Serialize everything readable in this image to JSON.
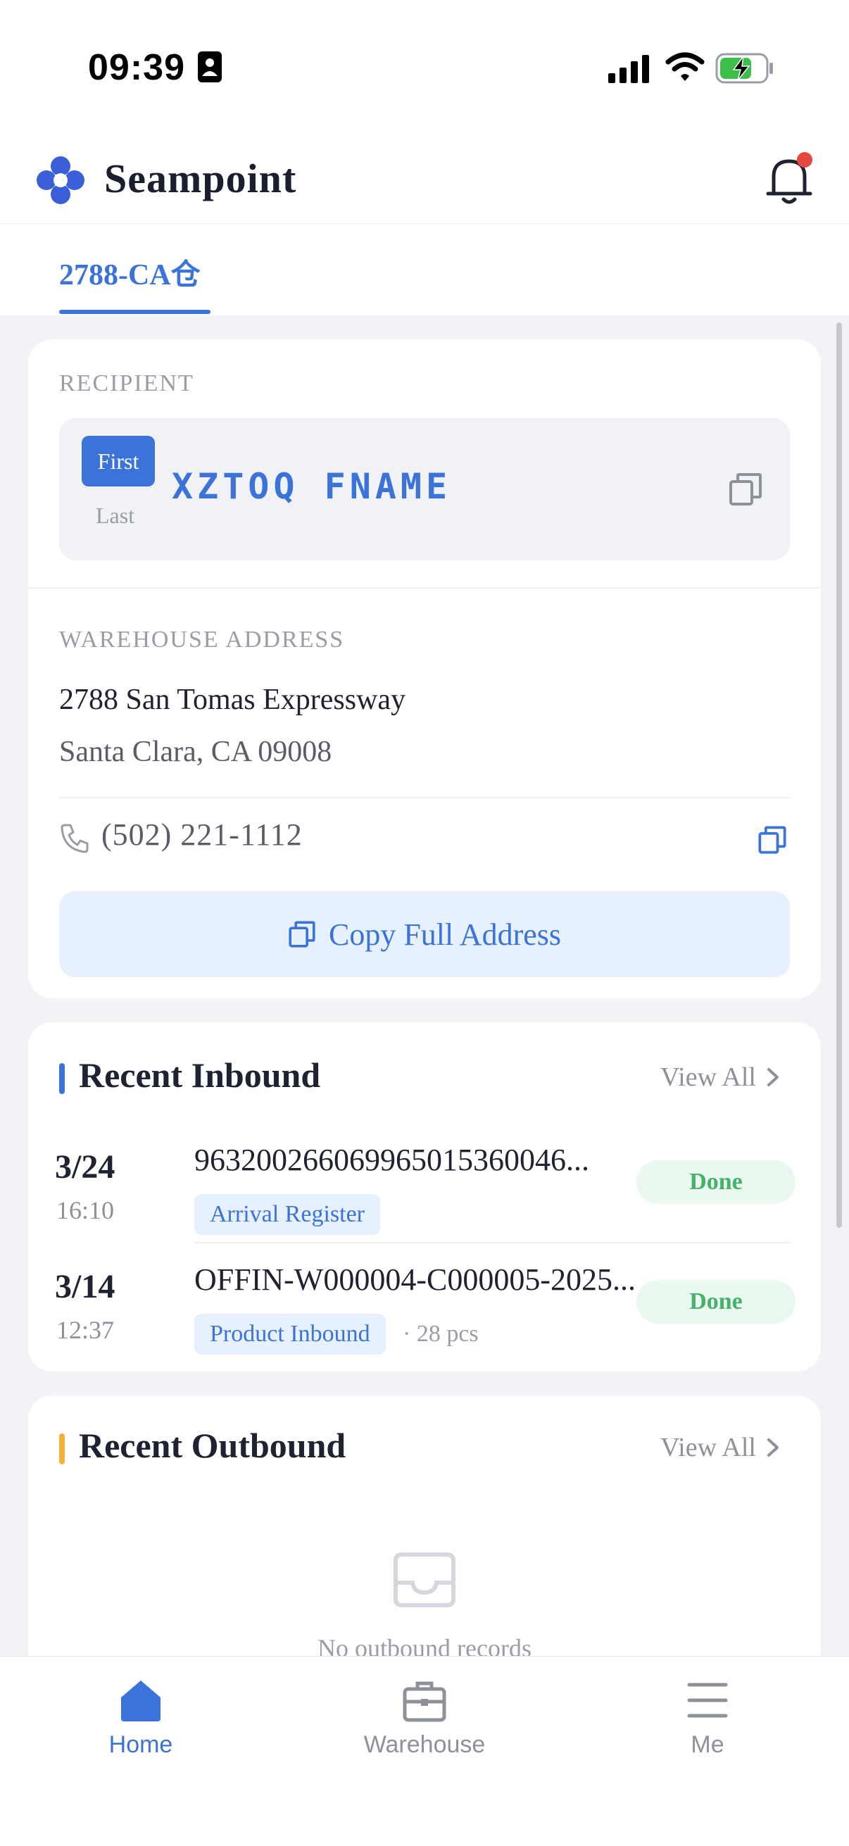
{
  "status_bar": {
    "time": "09:39",
    "icons": [
      "id-card-icon",
      "signal-icon",
      "wifi-icon",
      "battery-charging-icon"
    ]
  },
  "header": {
    "app_name": "Seampoint",
    "logo_icon": "seampoint-logo-icon",
    "notification_icon": "bell-icon",
    "has_unread": true
  },
  "tabs": [
    {
      "label": "2788-CA仓",
      "active": true
    }
  ],
  "address_card": {
    "recipient_label": "RECIPIENT",
    "first_badge": "First",
    "last_label": "Last",
    "recipient_name": "XZTOQ FNAME",
    "warehouse_label": "WAREHOUSE ADDRESS",
    "address_line1": "2788 San Tomas Expressway",
    "address_line2": "Santa Clara, CA 09008",
    "phone": "(502) 221-1112",
    "copy_full_label": "Copy Full Address"
  },
  "recent_inbound": {
    "title": "Recent Inbound",
    "view_all": "View All",
    "rows": [
      {
        "date": "3/24",
        "time": "16:10",
        "code": "963200266069965015360046...",
        "tag": "Arrival Register",
        "qty": "",
        "status": "Done"
      },
      {
        "date": "3/14",
        "time": "12:37",
        "code": "OFFIN-W000004-C000005-2025...",
        "tag": "Product Inbound",
        "qty": "· 28 pcs",
        "status": "Done"
      }
    ]
  },
  "recent_outbound": {
    "title": "Recent Outbound",
    "view_all": "View All",
    "empty_text": "No outbound records"
  },
  "bottom_nav": {
    "items": [
      {
        "label": "Home",
        "icon": "home-icon",
        "active": true
      },
      {
        "label": "Warehouse",
        "icon": "briefcase-icon",
        "active": false
      },
      {
        "label": "Me",
        "icon": "menu-icon",
        "active": false
      }
    ]
  },
  "colors": {
    "accent": "#3b73d9",
    "inbound_bar": "#3b73d9",
    "outbound_bar": "#f0b23a",
    "done_text": "#44b26b",
    "done_bg": "#eaf8ef",
    "notification_dot": "#e5483f"
  }
}
